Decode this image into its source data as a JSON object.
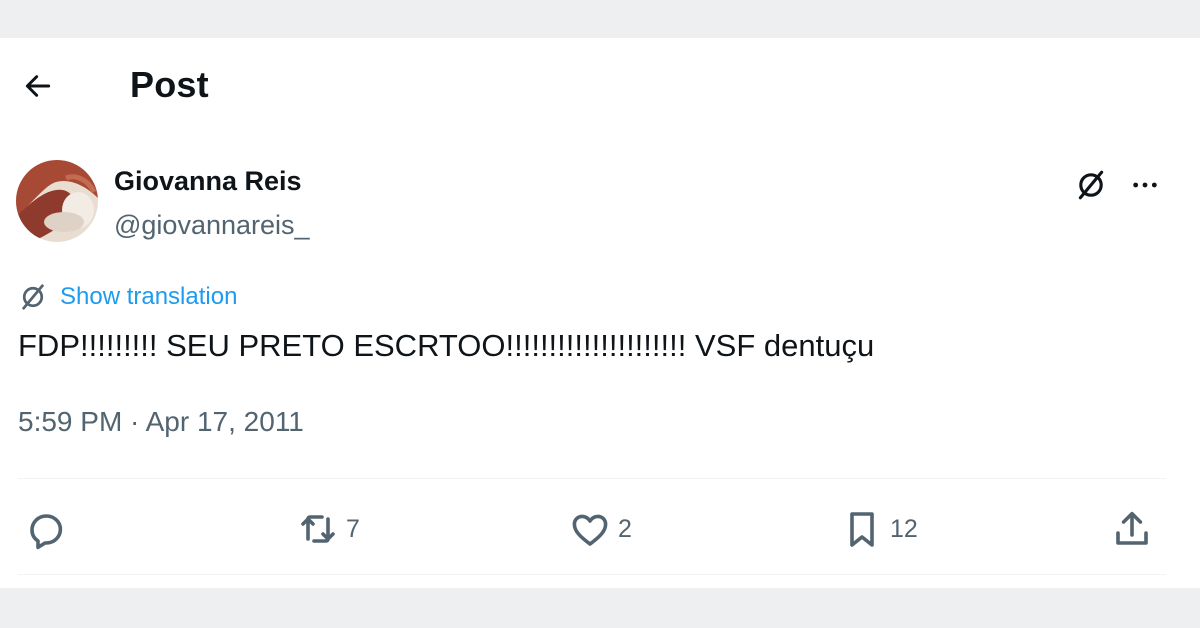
{
  "header": {
    "back_icon": "arrow-left-icon",
    "title": "Post"
  },
  "author": {
    "name": "Giovanna Reis",
    "handle": "@giovannareis_"
  },
  "post_menu": {
    "grok_icon": "slashed-circle-icon",
    "more_icon": "more-horizontal-icon"
  },
  "translation": {
    "icon": "slashed-circle-icon",
    "label": "Show translation"
  },
  "post": {
    "text": "FDP!!!!!!!!! SEU PRETO ESCRTOO!!!!!!!!!!!!!!!!!!!!! VSF dentuçu",
    "timestamp": "5:59 PM · Apr 17, 2011"
  },
  "actions": {
    "reply": {
      "icon": "reply-icon",
      "count": ""
    },
    "repost": {
      "icon": "repost-icon",
      "count": "7"
    },
    "like": {
      "icon": "heart-icon",
      "count": "2"
    },
    "bookmark": {
      "icon": "bookmark-icon",
      "count": "12"
    },
    "share": {
      "icon": "share-icon"
    }
  },
  "colors": {
    "link": "#1d9bf0",
    "text_primary": "#0f1419",
    "text_secondary": "#536471",
    "divider": "#eff3f4",
    "background": "#eeeff0"
  }
}
